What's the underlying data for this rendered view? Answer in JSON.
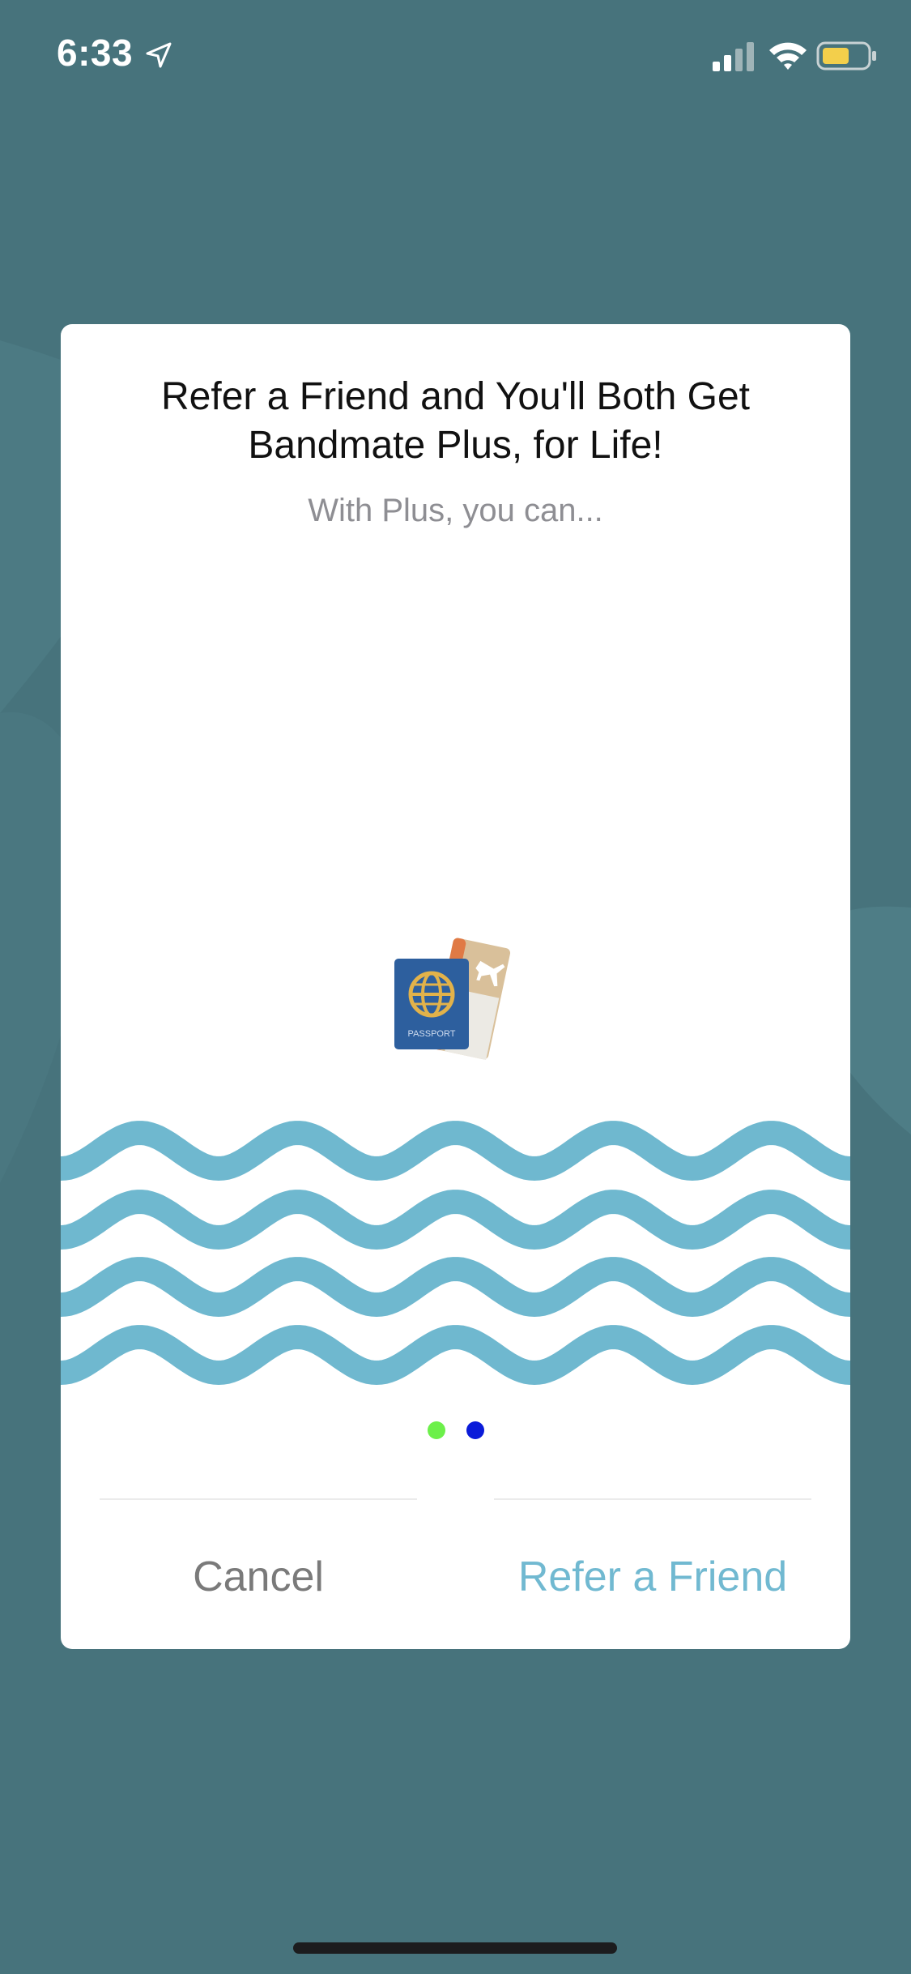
{
  "status_bar": {
    "time": "6:33",
    "location_icon": "location-arrow-icon",
    "signal_icon": "cellular-signal-icon",
    "wifi_icon": "wifi-icon",
    "battery_icon": "battery-icon"
  },
  "modal": {
    "title": "Refer a Friend and You'll Both Get Bandmate Plus, for Life!",
    "subtitle": "With Plus, you can...",
    "illustration_icon": "passport-ticket-icon",
    "illustration_label": "PASSPORT",
    "pagination": {
      "dots": [
        {
          "color": "#6cf04a",
          "active": false
        },
        {
          "color": "#0a1bd9",
          "active": true
        }
      ]
    },
    "cancel_label": "Cancel",
    "refer_label": "Refer a Friend"
  },
  "colors": {
    "background": "#47737c",
    "wave": "#6fb8cf",
    "refer_accent": "#71b9d1",
    "cancel_text": "#7a7a7a"
  }
}
